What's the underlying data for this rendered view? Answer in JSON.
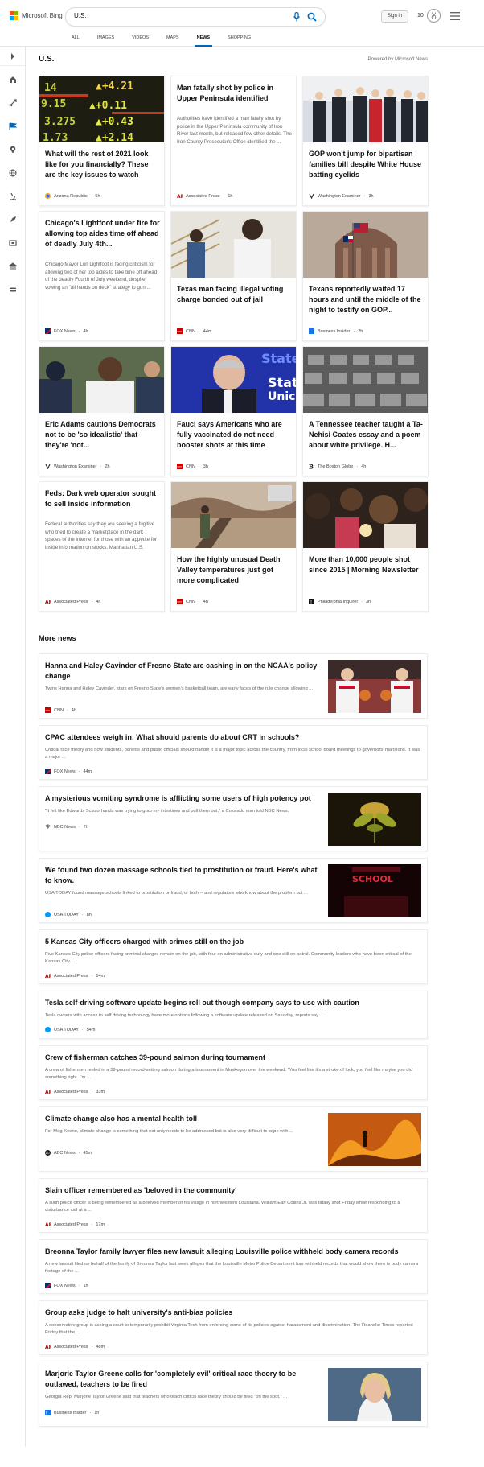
{
  "header": {
    "logo_text": "Microsoft Bing",
    "search_value": "U.S.",
    "signin_label": "Sign in",
    "points": "10",
    "colors": {
      "accent": "#0067b8",
      "logo_red": "#f25022",
      "logo_green": "#7fba00",
      "logo_blue": "#00a4ef",
      "logo_yellow": "#ffb900"
    },
    "tabs": [
      {
        "label": "ALL"
      },
      {
        "label": "IMAGES"
      },
      {
        "label": "VIDEOS"
      },
      {
        "label": "MAPS"
      },
      {
        "label": "NEWS",
        "active": true
      },
      {
        "label": "SHOPPING"
      }
    ]
  },
  "rail": {
    "icons": [
      "chevron-right-icon",
      "home-icon",
      "sports-icon",
      "us-flag-icon",
      "location-icon",
      "world-icon",
      "science-icon",
      "technology-icon",
      "entertainment-icon",
      "politics-icon",
      "money-icon"
    ]
  },
  "main": {
    "section_title": "U.S.",
    "powered_by": "Powered by Microsoft News",
    "cards": [
      {
        "title": "What will the rest of 2021 look like for you financially? These are the key issues to watch",
        "source": "Arizona Republic",
        "time": "5h",
        "snippet": "",
        "image": "stock-ticker-image"
      },
      {
        "title": "Man fatally shot by police in Upper Peninsula identified",
        "source": "Associated Press",
        "time": "1h",
        "snippet": "Authorities have identified a man fatally shot by police in the Upper Peninsula community of Iron River last month, but released few other details. The Iron County Prosecutor's Office identified the ...",
        "image": ""
      },
      {
        "title": "GOP won't jump for bipartisan families bill despite White House batting eyelids",
        "source": "Washington Examiner",
        "time": "3h",
        "snippet": "",
        "image": "white-house-group-image"
      },
      {
        "title": "Chicago's Lightfoot under fire for allowing top aides time off ahead of deadly July 4th...",
        "source": "FOX News",
        "time": "4h",
        "snippet": "Chicago Mayor Lori Lightfoot is facing criticism for allowing two of her top aides to take time off ahead of the deadly Fourth of July weekend, despite vowing an \"all hands on deck\" strategy to gun ...",
        "image": ""
      },
      {
        "title": "Texas man facing illegal voting charge bonded out of jail",
        "source": "CNN",
        "time": "44m",
        "snippet": "",
        "image": "texas-man-image"
      },
      {
        "title": "Texans reportedly waited 17 hours and until the middle of the night to testify on GOP...",
        "source": "Business Insider",
        "time": "2h",
        "snippet": "",
        "image": "texas-capitol-image"
      },
      {
        "title": "Eric Adams cautions Democrats not to be 'so idealistic' that they're 'not...",
        "source": "Washington Examiner",
        "time": "2h",
        "snippet": "",
        "image": "eric-adams-image"
      },
      {
        "title": "Fauci says Americans who are fully vaccinated do not need booster shots at this time",
        "source": "CNN",
        "time": "3h",
        "snippet": "",
        "image": "fauci-image"
      },
      {
        "title": "A Tennessee teacher taught a Ta-Nehisi Coates essay and a poem about white privilege. H...",
        "source": "The Boston Globe",
        "time": "4h",
        "snippet": "",
        "image": "classroom-image"
      },
      {
        "title": "Feds: Dark web operator sought to sell inside information",
        "source": "Associated Press",
        "time": "4h",
        "snippet": "Federal authorities say they are seeking a fugitive who tried to create a marketplace in the dark spaces of the internet for those with an appetite for inside information on stocks. Manhattan U.S.",
        "image": ""
      },
      {
        "title": "How the highly unusual Death Valley temperatures just got more complicated",
        "source": "CNN",
        "time": "4h",
        "snippet": "",
        "image": "death-valley-image"
      },
      {
        "title": "More than 10,000 people shot since 2015 | Morning Newsletter",
        "source": "Philadelphia Inquirer",
        "time": "3h",
        "snippet": "",
        "image": "vigil-crowd-image"
      }
    ],
    "more_news_title": "More news",
    "more_news": [
      {
        "title": "Hanna and Haley Cavinder of Fresno State are cashing in on the NCAA's policy change",
        "snippet": "Twins Hanna and Haley Cavinder, stars on Fresno State's women's basketball team, are early faces of the rule change allowing ...",
        "source": "CNN",
        "time": "4h",
        "image": "basketball-twins-image"
      },
      {
        "title": "CPAC attendees weigh in: What should parents do about CRT in schools?",
        "snippet": "Critical race theory and how students, parents and public officials should handle it is a major topic across the country, from local school board meetings to governors' mansions.  It was a major ...",
        "source": "FOX News",
        "time": "44m",
        "image": ""
      },
      {
        "title": "A mysterious vomiting syndrome is afflicting some users of high potency pot",
        "snippet": "\"It felt like Edwards Scissorhands was trying to grab my intestines and pull them out,\" a Colorado man told NBC News.",
        "source": "NBC News",
        "time": "7h",
        "image": "cannabis-plant-image"
      },
      {
        "title": "We found two dozen massage schools tied to prostitution or fraud. Here's what to know.",
        "snippet": "USA TODAY found massage schools linked to prostitution or fraud, or both -- and regulators who know about the problem but ...",
        "source": "USA TODAY",
        "time": "8h",
        "image": "massage-school-sign-image"
      },
      {
        "title": "5 Kansas City officers charged with crimes still on the job",
        "snippet": "Five Kansas City police officers facing criminal charges remain on the job, with four on administrative duty and one still on patrol. Community leaders who have been critical of the Kansas City ...",
        "source": "Associated Press",
        "time": "14m",
        "image": ""
      },
      {
        "title": "Tesla self-driving software update begins roll out though company says to use with caution",
        "snippet": "Tesla owners with access to self driving technology have more options following a software update released on Saturday, reports say ...",
        "source": "USA TODAY",
        "time": "54m",
        "image": ""
      },
      {
        "title": "Crew of fisherman catches 39-pound salmon during tournament",
        "snippet": "A crew of fishermen reeled in a 39-pound record-setting salmon during a tournament in Muskegon over the weekend. \"You feel like it's a stroke of luck, you feel like maybe you did something right. I'm ...",
        "source": "Associated Press",
        "time": "33m",
        "image": ""
      },
      {
        "title": "Climate change also has a mental health toll",
        "snippet": "For Meg Keene, climate change is something that not only needs to be addressed but is also very difficult to cope with ...",
        "source": "ABC News",
        "time": "45m",
        "image": "wildfire-image"
      },
      {
        "title": "Slain officer remembered as 'beloved in the community'",
        "snippet": "A slain police officer is being remembered as a beloved member of his village in northwestern Louisiana. William Earl Collins Jr. was fatally shot Friday while responding to a disturbance call at a ...",
        "source": "Associated Press",
        "time": "17m",
        "image": ""
      },
      {
        "title": "Breonna Taylor family lawyer files new lawsuit alleging Louisville police withheld body camera records",
        "snippet": "A new lawsuit filed on behalf of the family of Breonna Taylor last week alleges that the Louisville Metro Police Department has withheld records that would show there is body camera footage of the ...",
        "source": "FOX News",
        "time": "1h",
        "image": ""
      },
      {
        "title": "Group asks judge to halt university's anti-bias policies",
        "snippet": "A conservative group is asking a court to temporarily prohibit Virginia Tech from enforcing some of its policies against harassment and discrimination. The Roanoke Times reported Friday that the ...",
        "source": "Associated Press",
        "time": "48m",
        "image": ""
      },
      {
        "title": "Marjorie Taylor Greene calls for 'completely evil' critical race theory to be outlawed, teachers to be fired",
        "snippet": "Georgia Rep. Marjorie Taylor Greene said that teachers who teach critical race theory should be fired \"on the spot.\" ...",
        "source": "Business Insider",
        "time": "1h",
        "image": "greene-portrait-image"
      }
    ]
  },
  "footer": {
    "text": ""
  }
}
